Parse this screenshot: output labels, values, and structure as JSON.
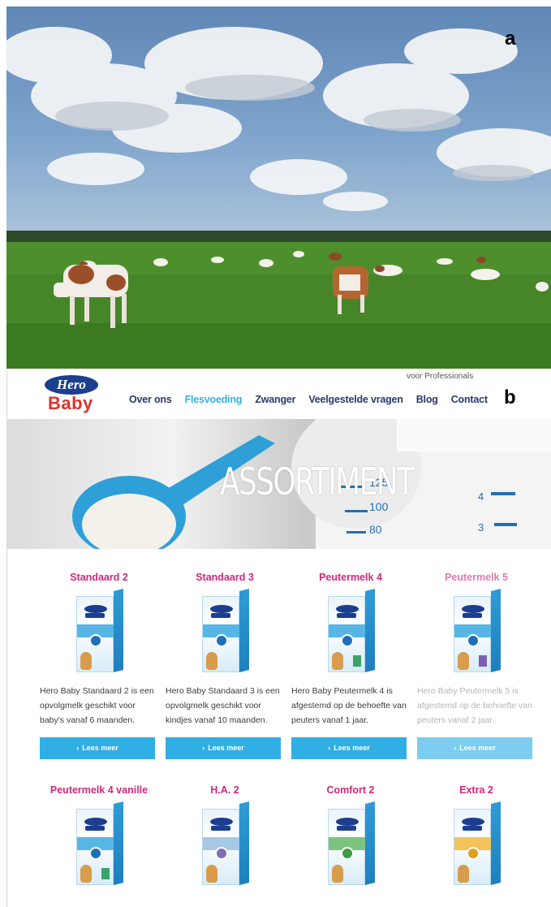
{
  "panel_a": {
    "label": "a"
  },
  "panel_b": {
    "label": "b",
    "logo": {
      "top": "Hero",
      "bottom": "Baby"
    },
    "pro_link": "voor Professionals",
    "nav": [
      {
        "label": "Over ons",
        "active": false
      },
      {
        "label": "Flesvoeding",
        "active": true
      },
      {
        "label": "Zwanger",
        "active": false
      },
      {
        "label": "Veelgestelde vragen",
        "active": false
      },
      {
        "label": "Blog",
        "active": false
      },
      {
        "label": "Contact",
        "active": false
      }
    ],
    "hero_title": "ASSORTIMENT",
    "hero_scale": [
      "125",
      "100",
      "80",
      "4",
      "3"
    ],
    "products": [
      {
        "name": "Standaard 2",
        "badge": "2",
        "desc": "Hero Baby Standaard 2 is een opvolgmelk geschikt voor baby's vanaf 6 maanden.",
        "button": "Lees meer"
      },
      {
        "name": "Standaard 3",
        "badge": "3",
        "desc": "Hero Baby Standaard 3 is een opvolgmelk geschikt voor kindjes vanaf 10 maanden.",
        "button": "Lees meer"
      },
      {
        "name": "Peutermelk 4",
        "badge": "4",
        "desc": "Hero Baby Peutermelk 4 is afgestemd op de behoefte van peuters vanaf 1 jaar.",
        "button": "Lees meer"
      },
      {
        "name": "Peutermelk 5",
        "badge": "5",
        "desc": "Hero Baby Peutermelk 5 is afgestemd op de behoefte van peuters vanaf 2 jaar.",
        "button": "Lees meer"
      },
      {
        "name": "Peutermelk 4 vanille",
        "badge": "4"
      },
      {
        "name": "H.A. 2",
        "badge": "2"
      },
      {
        "name": "Comfort 2",
        "badge": "2"
      },
      {
        "name": "Extra 2",
        "badge": "2"
      }
    ]
  },
  "colors": {
    "brand_blue": "#1b3e8f",
    "brand_red": "#e0312b",
    "accent_cyan": "#30afe4",
    "product_pink": "#d0287a"
  }
}
